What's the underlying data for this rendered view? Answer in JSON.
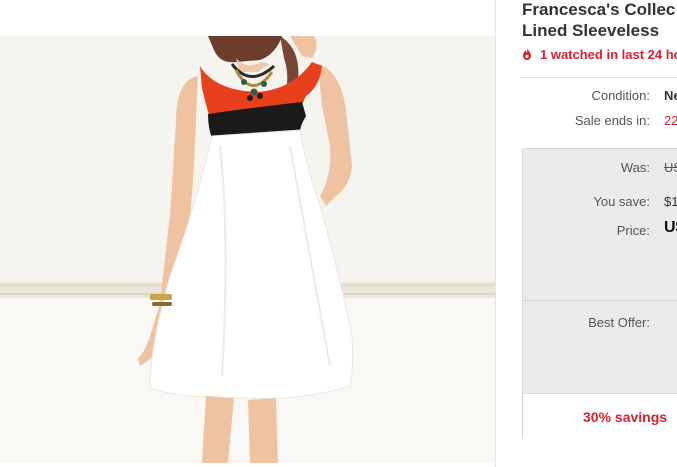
{
  "listing": {
    "title_line1": "Francesca's Collec",
    "title_line2": "Lined Sleeveless",
    "watching": "1 watched in last 24 ho",
    "condition_label": "Condition:",
    "condition_value": "Ne",
    "sale_ends_label": "Sale ends in:",
    "sale_ends_value": "22"
  },
  "pricing": {
    "was_label": "Was:",
    "was_value": "US",
    "save_label": "You save:",
    "save_value": "$1",
    "price_label": "Price:",
    "price_value": "U$",
    "best_offer_label": "Best Offer:",
    "savings_text": "30% savings"
  },
  "colors": {
    "accent_red": "#dd1e31",
    "dress_orange": "#e8401c"
  }
}
